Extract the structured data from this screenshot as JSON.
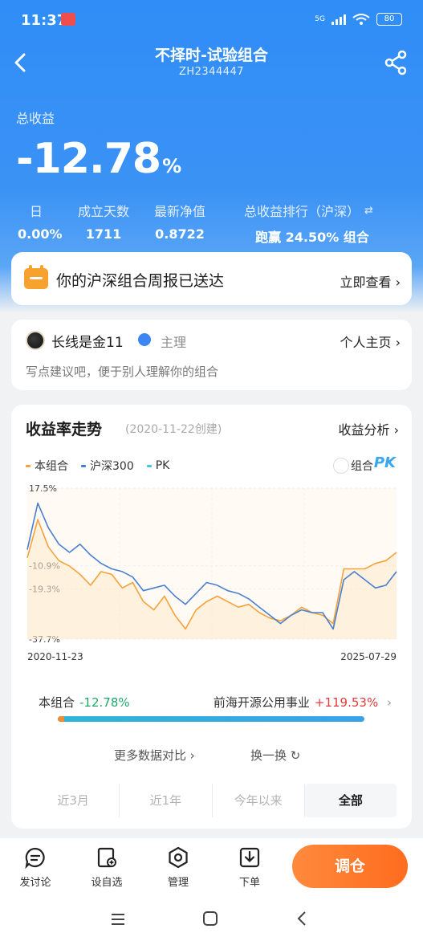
{
  "status_bar": {
    "time": "11:37",
    "network": "5G",
    "battery": "80"
  },
  "nav": {
    "title": "不择时-试验组合",
    "code": "ZH2344447"
  },
  "summary": {
    "total_return_label": "总收益",
    "total_return_value": "-12.78",
    "total_return_unit": "%",
    "stats": [
      {
        "label": "日",
        "value": "0.00%"
      },
      {
        "label": "成立天数",
        "value": "1711"
      },
      {
        "label": "最新净值",
        "value": "0.8722"
      },
      {
        "label": "总收益排行（沪深）",
        "value": "跑赢 24.50% 组合"
      }
    ]
  },
  "report": {
    "text": "你的沪深组合周报已送达",
    "link": "立即查看"
  },
  "owner": {
    "name": "长线是金11",
    "role": "主理",
    "home_link": "个人主页",
    "description": "写点建议吧，便于别人理解你的组合"
  },
  "chart_section": {
    "title": "收益率走势",
    "created": "(2020-11-22创建)",
    "analysis_link": "收益分析",
    "pk_label": "组合",
    "pk_badge": "PK"
  },
  "chart_data": {
    "type": "line",
    "x_start": "2020-11-23",
    "x_end": "2025-07-29",
    "xlabel": "",
    "ylabel": "",
    "y_ticks": [
      "17.5%",
      "-10.9%",
      "-19.3%",
      "-37.7%"
    ],
    "ylim": [
      -37.7,
      17.5
    ],
    "grid": true,
    "legend_position": "top-left",
    "x": [
      "2020-11",
      "2021-01",
      "2021-02",
      "2021-03",
      "2021-05",
      "2021-06",
      "2021-08",
      "2021-09",
      "2021-11",
      "2022-01",
      "2022-02",
      "2022-04",
      "2022-05",
      "2022-07",
      "2022-09",
      "2022-10",
      "2022-12",
      "2023-01",
      "2023-03",
      "2023-05",
      "2023-06",
      "2023-08",
      "2023-09",
      "2023-11",
      "2024-01",
      "2024-02",
      "2024-04",
      "2024-05",
      "2024-07",
      "2024-09",
      "2024-10",
      "2024-12",
      "2025-01",
      "2025-03",
      "2025-05",
      "2025-07"
    ],
    "series": [
      {
        "name": "本组合",
        "color": "#f5a23a",
        "values": [
          -8,
          6,
          -4,
          -9,
          -11,
          -14,
          -18,
          -13,
          -14,
          -19,
          -17,
          -24,
          -27,
          -22,
          -29,
          -34,
          -27,
          -24,
          -22,
          -24,
          -26,
          -25,
          -28,
          -30,
          -31,
          -29,
          -26,
          -28,
          -29,
          -32,
          -12,
          -12,
          -12,
          -10,
          -9,
          -6
        ]
      },
      {
        "name": "沪深300",
        "color": "#4a7fd0",
        "values": [
          -5,
          12,
          3,
          -3,
          -6,
          -3,
          -7,
          -10,
          -12,
          -13,
          -15,
          -20,
          -19,
          -18,
          -22,
          -25,
          -21,
          -17,
          -18,
          -20,
          -21,
          -23,
          -26,
          -29,
          -32,
          -29,
          -27,
          -28,
          -28,
          -34,
          -16,
          -13,
          -16,
          -19,
          -18,
          -13
        ]
      },
      {
        "name": "PK",
        "color": "#49c0e6",
        "values": []
      }
    ]
  },
  "comparison": {
    "left_label": "本组合",
    "left_value": "-12.78%",
    "right_label": "前海开源公用事业",
    "right_value": "+119.53%",
    "more_data": "更多数据对比",
    "swap": "换一换"
  },
  "period_tabs": [
    "近3月",
    "近1年",
    "今年以来",
    "全部"
  ],
  "toolbar": {
    "items": [
      "发讨论",
      "设自选",
      "管理",
      "下单"
    ],
    "trade_button": "调仓"
  }
}
